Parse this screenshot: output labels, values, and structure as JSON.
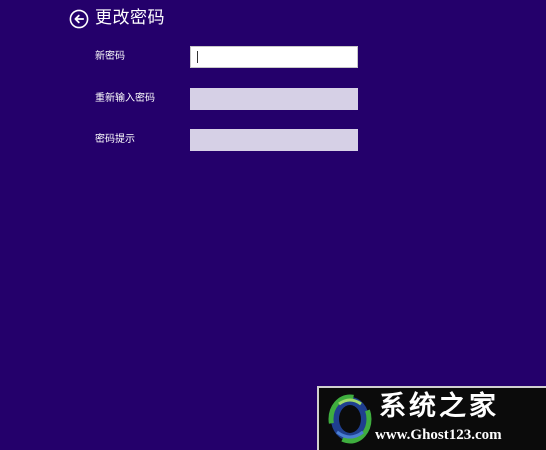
{
  "header": {
    "back_icon": "back-arrow-circle-icon",
    "title": "更改密码"
  },
  "form": {
    "fields": [
      {
        "label": "新密码",
        "value": "",
        "state": "focused"
      },
      {
        "label": "重新输入密码",
        "value": "",
        "state": "inactive"
      },
      {
        "label": "密码提示",
        "value": "",
        "state": "inactive"
      }
    ]
  },
  "colors": {
    "background": "#24006b",
    "text": "#ffffff",
    "input_active": "#ffffff",
    "input_inactive": "#d6d0e6"
  },
  "watermark": {
    "text": "系统之家",
    "url": "www.Ghost123.com",
    "logo_icon": "ghost-logo-icon"
  }
}
